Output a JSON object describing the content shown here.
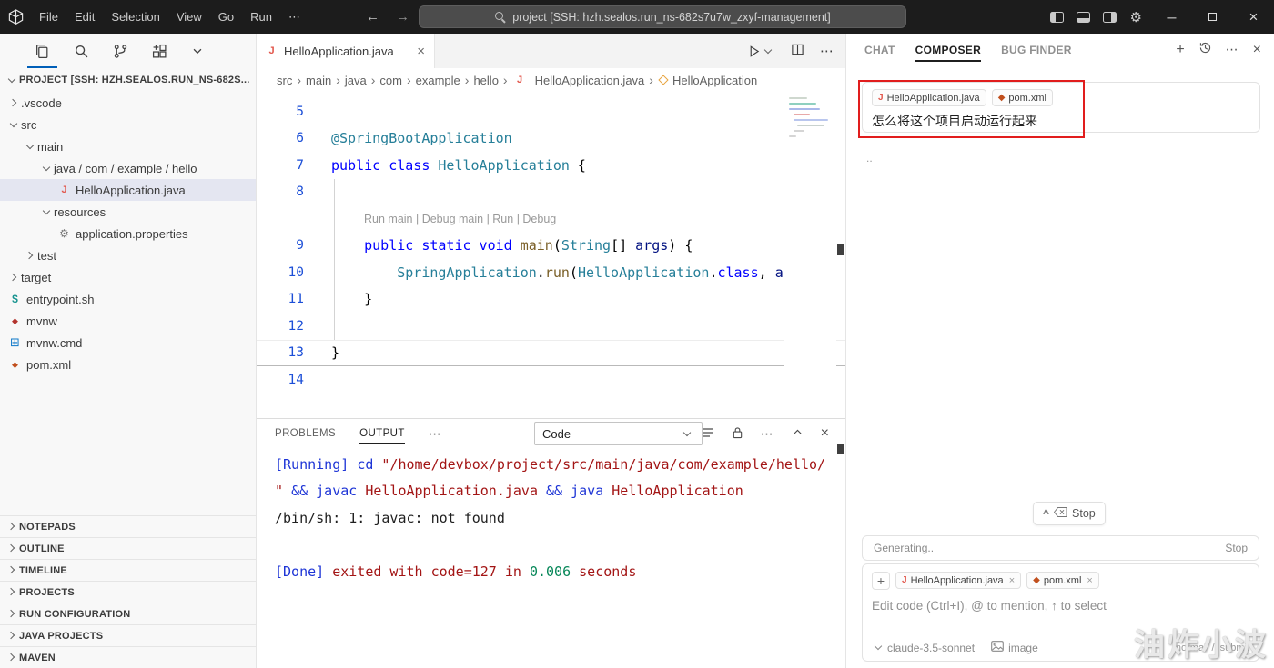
{
  "colors": {
    "titlebar_bg": "#1c1c1c",
    "activity_accent": "#005fb8",
    "tree_selection": "#e4e6f1",
    "annotation_red": "#e11d1d"
  },
  "titlebar": {
    "menus": [
      "File",
      "Edit",
      "Selection",
      "View",
      "Go",
      "Run",
      "⋯"
    ],
    "search_text": "project [SSH: hzh.sealos.run_ns-682s7u7w_zxyf-management]"
  },
  "explorer": {
    "title": "PROJECT [SSH: HZH.SEALOS.RUN_NS-682S...",
    "items": [
      {
        "label": ".vscode",
        "indent": 1,
        "chev": "right"
      },
      {
        "label": "src",
        "indent": 1,
        "chev": "down"
      },
      {
        "label": "main",
        "indent": 2,
        "chev": "down"
      },
      {
        "label": "java / com / example / hello",
        "indent": 3,
        "chev": "down"
      },
      {
        "label": "HelloApplication.java",
        "indent": 4,
        "icon": "java",
        "selected": true
      },
      {
        "label": "resources",
        "indent": 3,
        "chev": "down"
      },
      {
        "label": "application.properties",
        "indent": 4,
        "icon": "props"
      },
      {
        "label": "test",
        "indent": 2,
        "chev": "right"
      },
      {
        "label": "target",
        "indent": 1,
        "chev": "right"
      },
      {
        "label": "entrypoint.sh",
        "indent": 1,
        "icon": "sh"
      },
      {
        "label": "mvnw",
        "indent": 1,
        "icon": "mvn"
      },
      {
        "label": "mvnw.cmd",
        "indent": 1,
        "icon": "win"
      },
      {
        "label": "pom.xml",
        "indent": 1,
        "icon": "xml"
      }
    ],
    "sections": [
      "NOTEPADS",
      "OUTLINE",
      "TIMELINE",
      "PROJECTS",
      "RUN CONFIGURATION",
      "JAVA PROJECTS",
      "MAVEN"
    ]
  },
  "editor": {
    "tab_label": "HelloApplication.java",
    "breadcrumbs": [
      {
        "label": "src"
      },
      {
        "label": "main"
      },
      {
        "label": "java"
      },
      {
        "label": "com"
      },
      {
        "label": "example"
      },
      {
        "label": "hello"
      },
      {
        "label": "HelloApplication.java",
        "icon": "java"
      },
      {
        "label": "HelloApplication",
        "icon": "class"
      }
    ],
    "codelens": "Run main | Debug main | Run | Debug",
    "lines": [
      {
        "num": "5",
        "tokens": []
      },
      {
        "num": "6",
        "tokens": [
          {
            "t": "@SpringBootApplication",
            "c": "an"
          }
        ]
      },
      {
        "num": "7",
        "tokens": [
          {
            "t": "public class ",
            "c": "kw"
          },
          {
            "t": "HelloApplication",
            "c": "ty"
          },
          {
            "t": " {",
            "c": "pl"
          }
        ]
      },
      {
        "num": "8",
        "tokens": []
      },
      {
        "lens": true
      },
      {
        "num": "9",
        "tokens": [
          {
            "t": "    ",
            "c": "pl"
          },
          {
            "t": "public static void ",
            "c": "kw"
          },
          {
            "t": "main",
            "c": "fn"
          },
          {
            "t": "(",
            "c": "pl"
          },
          {
            "t": "String",
            "c": "ty"
          },
          {
            "t": "[] ",
            "c": "pl"
          },
          {
            "t": "args",
            "c": "vr"
          },
          {
            "t": ") {",
            "c": "pl"
          }
        ]
      },
      {
        "num": "10",
        "tokens": [
          {
            "t": "        ",
            "c": "pl"
          },
          {
            "t": "SpringApplication",
            "c": "ty"
          },
          {
            "t": ".",
            "c": "pl"
          },
          {
            "t": "run",
            "c": "fn"
          },
          {
            "t": "(",
            "c": "pl"
          },
          {
            "t": "HelloApplication",
            "c": "ty"
          },
          {
            "t": ".",
            "c": "pl"
          },
          {
            "t": "class",
            "c": "kw"
          },
          {
            "t": ", ",
            "c": "pl"
          },
          {
            "t": "ar",
            "c": "vr"
          }
        ]
      },
      {
        "num": "11",
        "tokens": [
          {
            "t": "    }",
            "c": "pl"
          }
        ]
      },
      {
        "num": "12",
        "tokens": []
      },
      {
        "num": "13",
        "tokens": [
          {
            "t": "}",
            "c": "pl"
          }
        ],
        "current": true
      },
      {
        "num": "14",
        "tokens": []
      }
    ]
  },
  "panel": {
    "tabs": [
      {
        "label": "PROBLEMS"
      },
      {
        "label": "OUTPUT",
        "active": true
      }
    ],
    "channel": "Code",
    "output": [
      [
        {
          "t": "[Running] ",
          "c": "blue"
        },
        {
          "t": "cd ",
          "c": "blue"
        },
        {
          "t": "\"/home/devbox/project/src/main/java/com/example/hello/",
          "c": "red"
        }
      ],
      [
        {
          "t": "\" ",
          "c": "red"
        },
        {
          "t": "&& ",
          "c": "blue"
        },
        {
          "t": "javac ",
          "c": "blue"
        },
        {
          "t": "HelloApplication.java ",
          "c": "red"
        },
        {
          "t": "&& ",
          "c": "blue"
        },
        {
          "t": "java ",
          "c": "blue"
        },
        {
          "t": "HelloApplication",
          "c": "red"
        }
      ],
      [
        {
          "t": "/bin/sh: 1: javac: not found",
          "c": "pl"
        }
      ],
      [],
      [
        {
          "t": "[Done] ",
          "c": "blue"
        },
        {
          "t": "exited with code=127 in ",
          "c": "red"
        },
        {
          "t": "0.006",
          "c": "green"
        },
        {
          "t": " seconds",
          "c": "red"
        }
      ]
    ]
  },
  "composer": {
    "tabs": [
      {
        "label": "CHAT"
      },
      {
        "label": "COMPOSER",
        "active": true
      },
      {
        "label": "BUG FINDER"
      }
    ],
    "message": {
      "chips": [
        {
          "label": "HelloApplication.java",
          "icon": "java"
        },
        {
          "label": "pom.xml",
          "icon": "xml"
        }
      ],
      "text": "怎么将这个项目启动运行起来"
    },
    "dots": "..",
    "stop_label": "Stop",
    "generating_label": "Generating..",
    "generating_stop": "Stop",
    "input_chips": [
      {
        "label": "HelloApplication.java",
        "icon": "java"
      },
      {
        "label": "pom.xml",
        "icon": "xml"
      }
    ],
    "placeholder": "Edit code (Ctrl+I), @ to mention, ↑ to select",
    "model": "claude-3.5-sonnet",
    "image_label": "image",
    "mode_hint": "normal",
    "slash": "/",
    "submit_hint": "submit",
    "watermark": "油炸小波"
  }
}
